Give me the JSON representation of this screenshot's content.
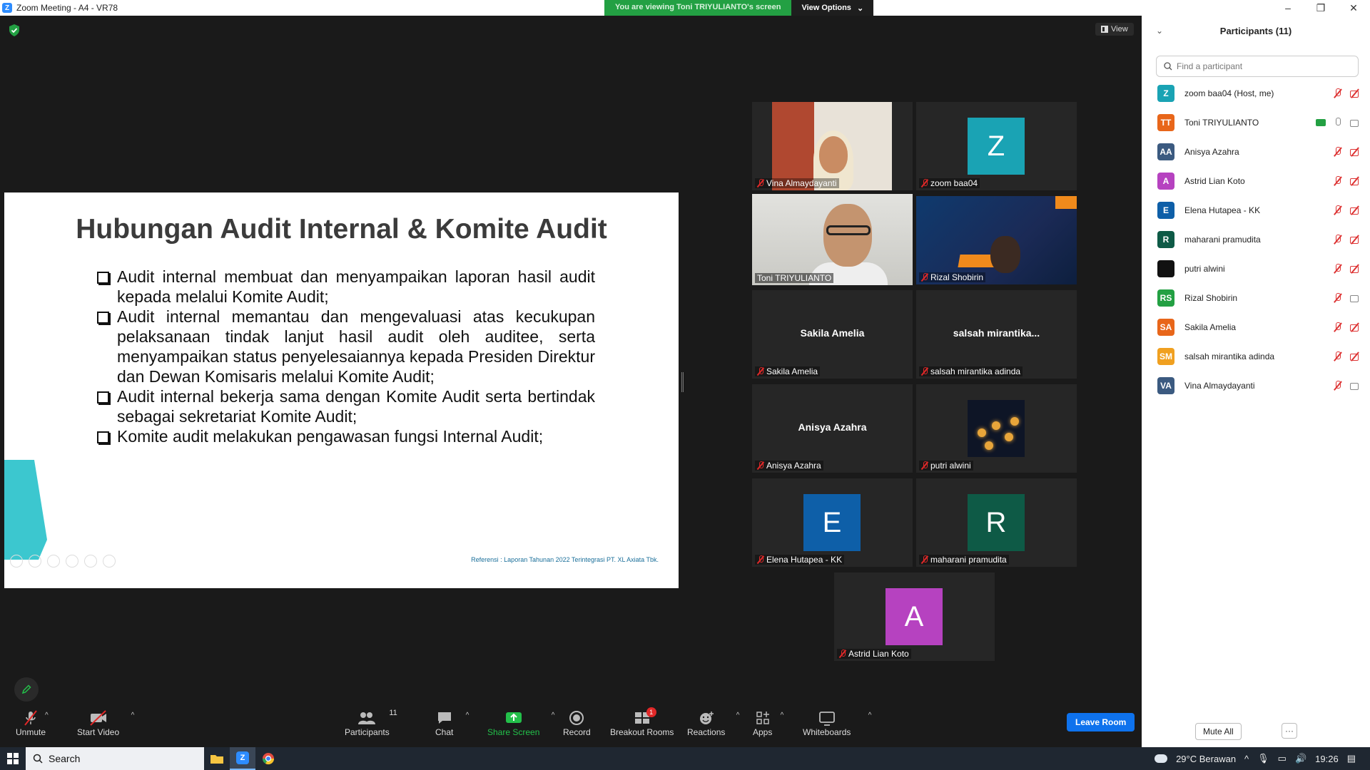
{
  "window": {
    "title": "Zoom Meeting - A4 - VR78",
    "viewing_banner": "You are viewing Toni TRIYULIANTO's screen",
    "view_options": "View Options",
    "view_label": "View"
  },
  "slide": {
    "title": "Hubungan Audit Internal & Komite Audit",
    "bullets": [
      "Audit internal membuat dan menyampaikan laporan hasil audit kepada melalui Komite Audit;",
      "Audit internal memantau dan mengevaluasi atas kecukupan pelaksanaan tindak lanjut hasil audit oleh auditee, serta menyampaikan status penyelesaiannya kepada Presiden Direktur dan Dewan Komisaris melalui Komite Audit;",
      "Audit internal bekerja sama dengan Komite Audit serta bertindak sebagai sekretariat Komite Audit;",
      "Komite audit melakukan pengawasan fungsi Internal Audit;"
    ],
    "reference": "Referensi : Laporan Tahunan 2022 Terintegrasi PT. XL Axiata Tbk."
  },
  "tiles": {
    "vina": {
      "label": "Vina Almaydayanti"
    },
    "zoom": {
      "label": "zoom baa04",
      "initial": "Z",
      "color": "#1aa3b4"
    },
    "toni": {
      "label": "Toni TRIYULIANTO"
    },
    "rizal": {
      "label": "Rizal Shobirin"
    },
    "sakila": {
      "label": "Sakila Amelia",
      "bigname": "Sakila Amelia"
    },
    "salsah": {
      "label": "salsah mirantika adinda",
      "bigname": "salsah  mirantika..."
    },
    "anisya": {
      "label": "Anisya Azahra",
      "bigname": "Anisya Azahra"
    },
    "putri": {
      "label": "putri alwini"
    },
    "elena": {
      "label": "Elena Hutapea - KK",
      "initial": "E",
      "color": "#0e5fa8"
    },
    "maharani": {
      "label": "maharani pramudita",
      "initial": "R",
      "color": "#0e5a46"
    },
    "astrid": {
      "label": "Astrid Lian Koto",
      "initial": "A",
      "color": "#b642c0"
    }
  },
  "toolbar": {
    "unmute": "Unmute",
    "start_video": "Start Video",
    "participants": "Participants",
    "participants_count": "11",
    "chat": "Chat",
    "share_screen": "Share Screen",
    "record": "Record",
    "breakout_rooms": "Breakout Rooms",
    "breakout_badge": "1",
    "reactions": "Reactions",
    "apps": "Apps",
    "whiteboards": "Whiteboards",
    "leave_room": "Leave Room"
  },
  "panel": {
    "title": "Participants (11)",
    "search_placeholder": "Find a participant",
    "mute_all": "Mute All",
    "more": "···",
    "participants": [
      {
        "initials": "Z",
        "name": "zoom baa04 (Host, me)",
        "color": "#1aa3b4",
        "mic": "off",
        "cam": "off"
      },
      {
        "initials": "TT",
        "name": "Toni TRIYULIANTO",
        "color": "#e8661a",
        "mic": "on",
        "cam": "on",
        "sharing": true
      },
      {
        "initials": "AA",
        "name": "Anisya Azahra",
        "color": "#3b5a80",
        "mic": "off",
        "cam": "off"
      },
      {
        "initials": "A",
        "name": "Astrid Lian Koto",
        "color": "#b642c0",
        "mic": "off",
        "cam": "off"
      },
      {
        "initials": "E",
        "name": "Elena Hutapea - KK",
        "color": "#0e5fa8",
        "mic": "off",
        "cam": "off"
      },
      {
        "initials": "R",
        "name": "maharani pramudita",
        "color": "#0e5a46",
        "mic": "off",
        "cam": "off"
      },
      {
        "initials": "",
        "name": "putri alwini",
        "color": "#111111",
        "mic": "off",
        "cam": "off"
      },
      {
        "initials": "RS",
        "name": "Rizal Shobirin",
        "color": "#23a043",
        "mic": "off",
        "cam": "on"
      },
      {
        "initials": "SA",
        "name": "Sakila Amelia",
        "color": "#e8661a",
        "mic": "off",
        "cam": "off"
      },
      {
        "initials": "SM",
        "name": "salsah mirantika adinda",
        "color": "#f0a020",
        "mic": "off",
        "cam": "off"
      },
      {
        "initials": "VA",
        "name": "Vina Almaydayanti",
        "color": "#3b5a80",
        "mic": "off",
        "cam": "on"
      }
    ]
  },
  "taskbar": {
    "search": "Search",
    "weather": "29°C  Berawan",
    "time": "19:26"
  }
}
